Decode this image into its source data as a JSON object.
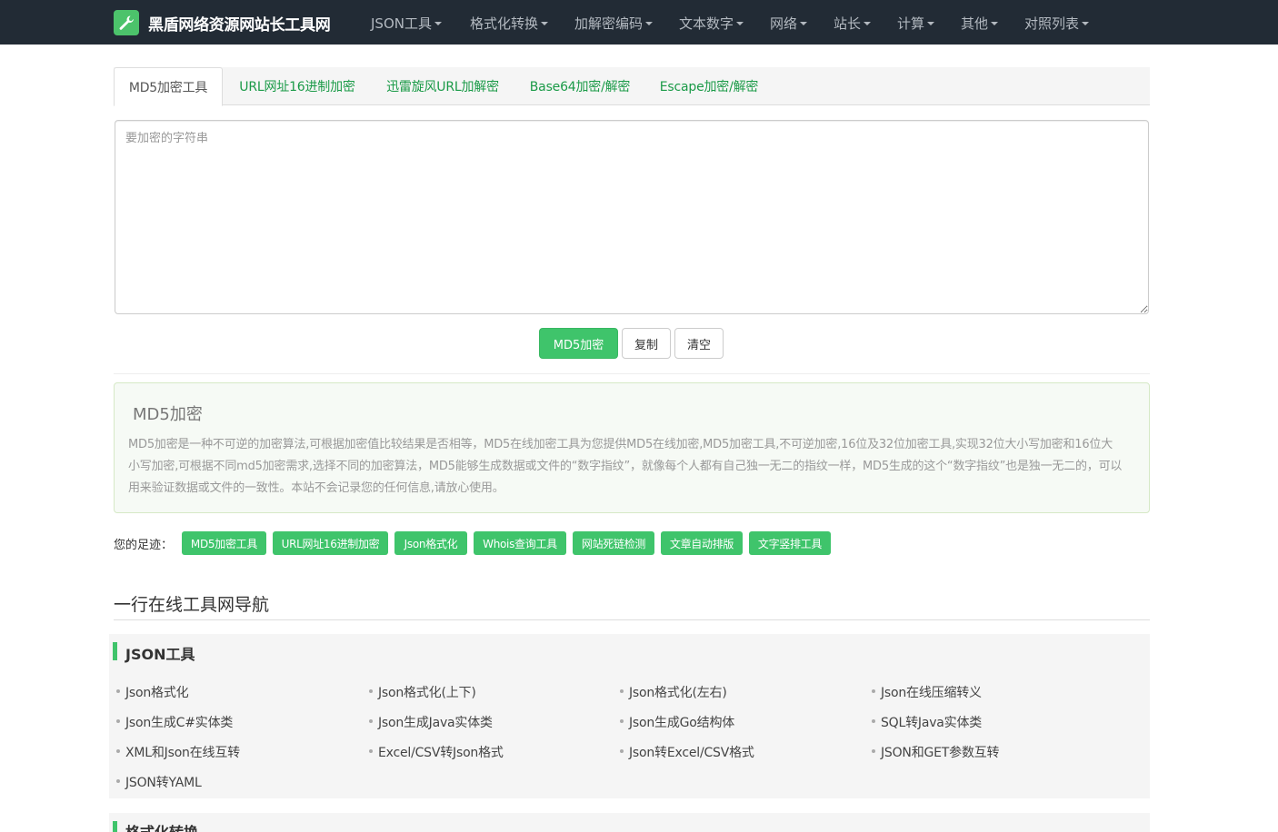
{
  "navbar": {
    "brand_icon": "wrench-icon",
    "title": "黑盾网络资源网站长工具网",
    "menus": [
      "JSON工具",
      "格式化转换",
      "加解密编码",
      "文本数字",
      "网络",
      "站长",
      "计算",
      "其他",
      "对照列表"
    ]
  },
  "tabs": [
    "MD5加密工具",
    "URL网址16进制加密",
    "迅雷旋风URL加解密",
    "Base64加密/解密",
    "Escape加密/解密"
  ],
  "input": {
    "placeholder": "要加密的字符串",
    "value": ""
  },
  "buttons": {
    "encrypt": "MD5加密",
    "copy": "复制",
    "clear": "清空"
  },
  "info": {
    "title": "MD5加密",
    "text": "MD5加密是一种不可逆的加密算法,可根据加密值比较结果是否相等，MD5在线加密工具为您提供MD5在线加密,MD5加密工具,不可逆加密,16位及32位加密工具,实现32位大小写加密和16位大小写加密,可根据不同md5加密需求,选择不同的加密算法，MD5能够生成数据或文件的“数字指纹”，就像每个人都有自己独一无二的指纹一样，MD5生成的这个“数字指纹”也是独一无二的，可以用来验证数据或文件的一致性。本站不会记录您的任何信息,请放心使用。"
  },
  "footprints": {
    "label": "您的足迹：",
    "tags": [
      "MD5加密工具",
      "URL网址16进制加密",
      "Json格式化",
      "Whois查询工具",
      "网站死链检测",
      "文章自动排版",
      "文字竖排工具"
    ]
  },
  "nav_section": {
    "title": "一行在线工具网导航",
    "categories": [
      {
        "title": "JSON工具",
        "links": [
          "Json格式化",
          "Json格式化(上下)",
          "Json格式化(左右)",
          "Json在线压缩转义",
          "Json生成C#实体类",
          "Json生成Java实体类",
          "Json生成Go结构体",
          "SQL转Java实体类",
          "XML和Json在线互转",
          "Excel/CSV转Json格式",
          "Json转Excel/CSV格式",
          "JSON和GET参数互转",
          "JSON转YAML"
        ]
      },
      {
        "title": "格式化转换",
        "links": []
      }
    ]
  },
  "colors": {
    "navbar": "#222b35",
    "accent": "#3fc46b",
    "tab_link": "#1a9a47"
  }
}
